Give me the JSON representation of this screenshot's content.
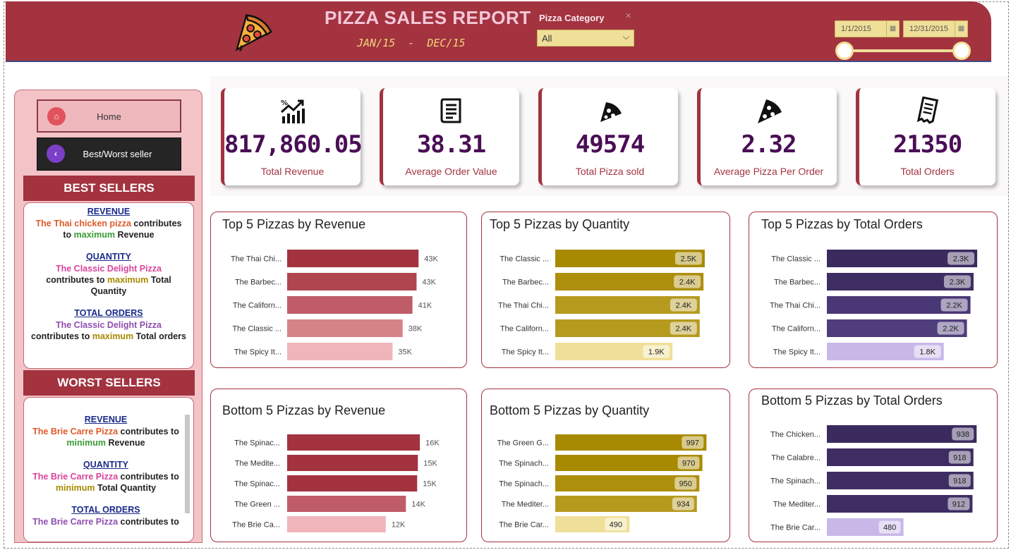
{
  "header": {
    "title": "PIZZA SALES REPORT",
    "subtitle": "JAN/15  -  DEC/15",
    "category_label": "Pizza Category",
    "category_value": "All",
    "date_start": "1/1/2015",
    "date_end": "12/31/2015"
  },
  "sidebar": {
    "home_label": "Home",
    "best_worst_label": "Best/Worst seller",
    "best_title": "BEST SELLERS",
    "worst_title": "WORST SELLERS",
    "best": {
      "revenue_head": "REVENUE",
      "revenue_pizza": "The Thai chicken pizza",
      "revenue_mid": " contributes to ",
      "revenue_key": "maximum",
      "revenue_end": " Revenue",
      "quantity_head": "QUANTITY",
      "quantity_pizza": "The Classic Delight Pizza",
      "quantity_mid": "contributes to ",
      "quantity_key": "maximum",
      "quantity_end": " Total Quantity",
      "orders_head": "TOTAL ORDERS",
      "orders_pizza": "The Classic Delight Pizza",
      "orders_mid": "contributes to ",
      "orders_key": "maximum",
      "orders_end": " Total orders"
    },
    "worst": {
      "revenue_head": "REVENUE",
      "revenue_pizza": "The Brie Carre Pizza",
      "revenue_mid": " contributes to ",
      "revenue_key": "minimum",
      "revenue_end": " Revenue",
      "quantity_head": "QUANTITY",
      "quantity_pizza": "The Brie Carre Pizza",
      "quantity_mid": " contributes to ",
      "quantity_key": "minimum",
      "quantity_end": " Total Quantity",
      "orders_head": "TOTAL ORDERS",
      "orders_pizza": "The Brie Carre Pizza",
      "orders_mid": " contributes to"
    }
  },
  "kpis": [
    {
      "value": "817,860.05",
      "label": "Total Revenue",
      "icon": "revenue-growth-icon"
    },
    {
      "value": "38.31",
      "label": "Average Order Value",
      "icon": "receipt-icon"
    },
    {
      "value": "49574",
      "label": "Total Pizza sold",
      "icon": "pizza-slice-icon"
    },
    {
      "value": "2.32",
      "label": "Average Pizza Per Order",
      "icon": "pizza-slice-icon"
    },
    {
      "value": "21350",
      "label": "Total Orders",
      "icon": "order-list-icon"
    }
  ],
  "colors": {
    "brand": "#A2333F",
    "kpi_value": "#4A0E55",
    "gold": "#F0DF98"
  },
  "chart_data": [
    {
      "id": "top-revenue",
      "type": "bar",
      "orientation": "horizontal",
      "title": "Top 5 Pizzas by Revenue",
      "categories": [
        "The Thai Chi...",
        "The Barbec...",
        "The Californ...",
        "The Classic ...",
        "The Spicy It..."
      ],
      "values": [
        43434,
        42768,
        41410,
        38180,
        34831
      ],
      "data_labels": [
        "43K",
        "43K",
        "41K",
        "38K",
        "35K"
      ],
      "xlim": [
        0,
        45000
      ],
      "colors": [
        "#A2333F",
        "#B04550",
        "#C05C67",
        "#D48487",
        "#EFB5BB"
      ],
      "label_style": "plain"
    },
    {
      "id": "top-quantity",
      "type": "bar",
      "orientation": "horizontal",
      "title": "Top 5 Pizzas by Quantity",
      "categories": [
        "The Classic ...",
        "The Barbec...",
        "The Thai Chi...",
        "The Californ...",
        "The Spicy It..."
      ],
      "values": [
        2453,
        2432,
        2371,
        2370,
        1924
      ],
      "data_labels": [
        "2.5K",
        "2.4K",
        "2.4K",
        "2.4K",
        "1.9K"
      ],
      "xlim": [
        0,
        2500
      ],
      "colors": [
        "#A88A00",
        "#AD8F0C",
        "#B59A1E",
        "#B59A1E",
        "#F0DF98"
      ],
      "label_style": "badge"
    },
    {
      "id": "top-orders",
      "type": "bar",
      "orientation": "horizontal",
      "title": "Top 5 Pizzas by Total Orders",
      "categories": [
        "The Classic ...",
        "The Barbec...",
        "The Thai Chi...",
        "The Californ...",
        "The Spicy It..."
      ],
      "values": [
        2329,
        2273,
        2225,
        2170,
        1811
      ],
      "data_labels": [
        "2.3K",
        "2.3K",
        "2.2K",
        "2.2K",
        "1.8K"
      ],
      "xlim": [
        0,
        2350
      ],
      "colors": [
        "#3B2A5E",
        "#3E2D63",
        "#4A3876",
        "#4F3D7C",
        "#C8B8E8"
      ],
      "label_style": "badge"
    },
    {
      "id": "bottom-revenue",
      "type": "bar",
      "orientation": "horizontal",
      "title": "Bottom 5 Pizzas by Revenue",
      "categories": [
        "The Spinac...",
        "The Medite...",
        "The Spinac...",
        "The Green ...",
        "The Brie Ca..."
      ],
      "values": [
        15596,
        15361,
        15277,
        13956,
        11588
      ],
      "data_labels": [
        "16K",
        "15K",
        "15K",
        "14K",
        "12K"
      ],
      "xlim": [
        0,
        16000
      ],
      "colors": [
        "#A2333F",
        "#A2333F",
        "#A2333F",
        "#C05C67",
        "#EFB5BB"
      ],
      "label_style": "plain"
    },
    {
      "id": "bottom-quantity",
      "type": "bar",
      "orientation": "horizontal",
      "title": "Bottom 5 Pizzas by Quantity",
      "categories": [
        "The Green G...",
        "The Spinach...",
        "The Spinach...",
        "The Mediter...",
        "The Brie Car..."
      ],
      "values": [
        997,
        970,
        950,
        934,
        490
      ],
      "data_labels": [
        "997",
        "970",
        "950",
        "934",
        "490"
      ],
      "xlim": [
        0,
        1000
      ],
      "colors": [
        "#A88A00",
        "#A88A00",
        "#AD8F0C",
        "#B59A1E",
        "#F0DF98"
      ],
      "label_style": "badge"
    },
    {
      "id": "bottom-orders",
      "type": "bar",
      "orientation": "horizontal",
      "title": "Bottom 5 Pizzas by Total Orders",
      "categories": [
        "The Chicken...",
        "The Calabre...",
        "The Spinach...",
        "The Mediter...",
        "The Brie Car..."
      ],
      "values": [
        938,
        918,
        918,
        912,
        480
      ],
      "data_labels": [
        "938",
        "918",
        "918",
        "912",
        "480"
      ],
      "xlim": [
        0,
        950
      ],
      "colors": [
        "#3B2A5E",
        "#3E2D63",
        "#3E2D63",
        "#3E2D63",
        "#C8B8E8"
      ],
      "label_style": "badge"
    }
  ]
}
